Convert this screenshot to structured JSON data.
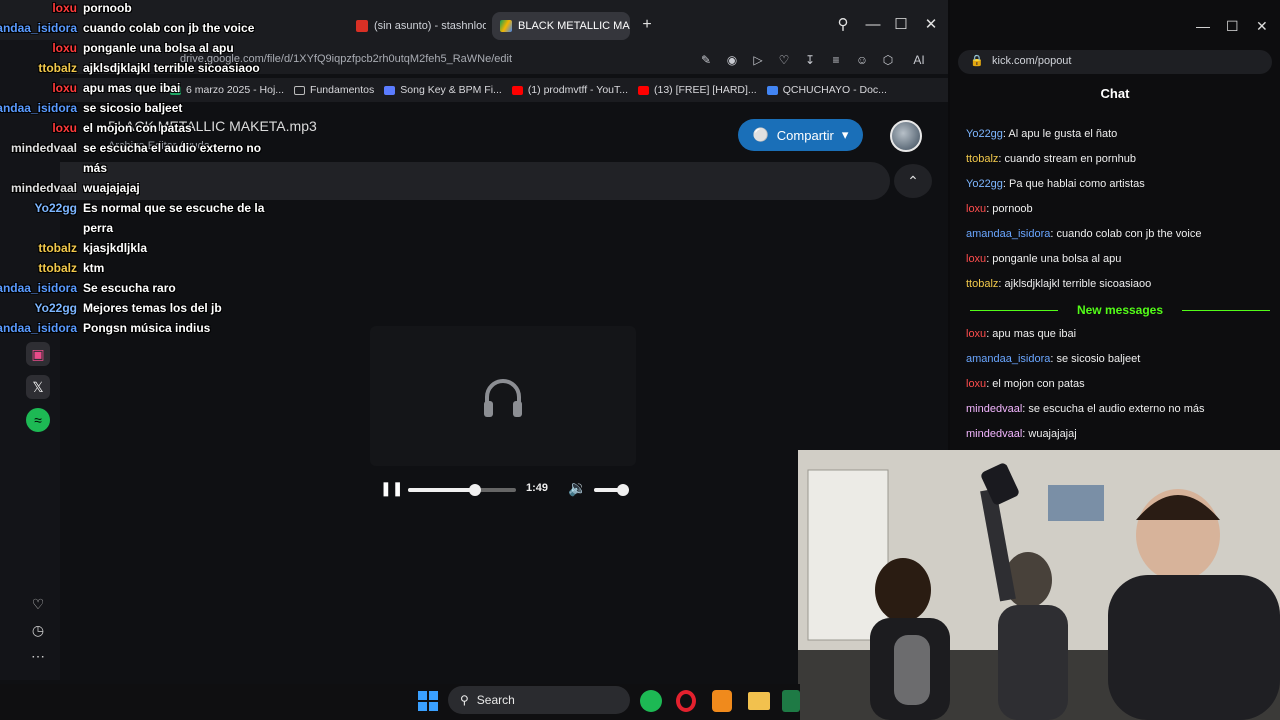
{
  "browser": {
    "tabs": [
      {
        "label": "(sin asunto) - stashnloops",
        "icon": "gmail-icon"
      },
      {
        "label": "BLACK METALLIC MA",
        "icon": "drive-icon",
        "active": true
      }
    ],
    "new_tab": "+",
    "url": "drive.google.com/file/d/1XYfQ9iqpzfpcb2rh0utqM2feh5_RaWNe/edit",
    "ai_label": "AI"
  },
  "bookmarks": [
    {
      "label": "6 marzo 2025 - Hoj...",
      "color": "#1fa463"
    },
    {
      "label": "Fundamentos",
      "color": "#888888"
    },
    {
      "label": "Song Key & BPM Fi...",
      "color": "#5b7cff"
    },
    {
      "label": "(1) prodmvtff - YouT...",
      "color": "#ff0000"
    },
    {
      "label": "(13) [FREE] [HARD]...",
      "color": "#ff0000"
    },
    {
      "label": "QCHUCHAYO - Doc...",
      "color": "#4285f4"
    }
  ],
  "drive": {
    "file_title": "BLACK METALLIC MAKETA.mp3",
    "subtitle": "Archivo Editar Ayuda",
    "share_label": "Compartir",
    "player": {
      "time": "1:49",
      "progress": 0.62,
      "volume": 0.85
    }
  },
  "overlay_chat": [
    {
      "user": "loxu",
      "message": "pornoob",
      "color": "#ff3b3b"
    },
    {
      "user": "amandaa_isidora",
      "message": "cuando colab con jb the voice",
      "color": "#5a9bff"
    },
    {
      "user": "loxu",
      "message": "ponganle una bolsa al apu",
      "color": "#ff3b3b"
    },
    {
      "user": "ttobalz",
      "message": "ajklsdjklajkl terrible sicoasiaoo",
      "color": "#f2c94c"
    },
    {
      "user": "loxu",
      "message": "apu mas que ibai",
      "color": "#ff3b3b"
    },
    {
      "user": "amandaa_isidora",
      "message": "se sicosio baljeet",
      "color": "#5a9bff"
    },
    {
      "user": "loxu",
      "message": "el mojon con patas",
      "color": "#ff3b3b"
    },
    {
      "user": "mindedvaal",
      "message": "se escucha el audio externo no",
      "message2": "más",
      "color": "#e0e0e0"
    },
    {
      "user": "mindedvaal",
      "message": "wuajajajaj",
      "color": "#e0e0e0"
    },
    {
      "user": "Yo22gg",
      "message": "Es normal que se escuche de la",
      "message2": "perra",
      "color": "#7db6ff"
    },
    {
      "user": "ttobalz",
      "message": "kjasjkdljkla",
      "color": "#f2c94c"
    },
    {
      "user": "ttobalz",
      "message": "ktm",
      "color": "#f2c94c"
    },
    {
      "user": "amandaa_isidora",
      "message": "Se escucha raro",
      "color": "#5a9bff"
    },
    {
      "user": "Yo22gg",
      "message": "Mejores temas los del jb",
      "color": "#7db6ff"
    },
    {
      "user": "amandaa_isidora",
      "message": "Pongsn música indius",
      "color": "#5a9bff"
    }
  ],
  "kick": {
    "url": "kick.com/popout",
    "header": "Chat",
    "messages": [
      {
        "user": "Yo22gg",
        "text": ": Al apu le gusta el ñato",
        "color": "#7db6ff"
      },
      {
        "user": "ttobalz",
        "text": ": cuando stream en pornhub",
        "color": "#f2c94c"
      },
      {
        "user": "Yo22gg",
        "text": ": Pa que hablai como artistas",
        "color": "#7db6ff"
      },
      {
        "user": "loxu",
        "text": ": pornoob",
        "color": "#ff4d4d"
      },
      {
        "user": "amandaa_isidora",
        "text": ": cuando colab con jb the voice",
        "color": "#6aa6ff"
      },
      {
        "user": "loxu",
        "text": ": ponganle una bolsa al apu",
        "color": "#ff4d4d"
      },
      {
        "user": "ttobalz",
        "text": ": ajklsdjklajkl terrible sicoasiaoo",
        "color": "#f2c94c"
      }
    ],
    "new_messages_label": "New messages",
    "new_messages": [
      {
        "user": "loxu",
        "text": ": apu mas que ibai",
        "color": "#ff4d4d"
      },
      {
        "user": "amandaa_isidora",
        "text": ": se sicosio baljeet",
        "color": "#6aa6ff"
      },
      {
        "user": "loxu",
        "text": ": el mojon con patas",
        "color": "#ff4d4d"
      },
      {
        "user": "mindedvaal",
        "text": ": se escucha el audio externo no más",
        "color": "#f3b6ff"
      },
      {
        "user": "mindedvaal",
        "text": ": wuajajajaj",
        "color": "#f3b6ff"
      }
    ]
  },
  "taskbar": {
    "search_label": "Search"
  }
}
